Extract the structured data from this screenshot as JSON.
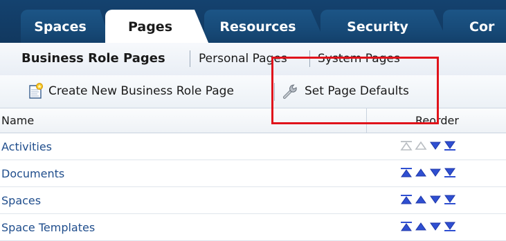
{
  "tabs": [
    {
      "label": "Spaces",
      "active": false
    },
    {
      "label": "Pages",
      "active": true
    },
    {
      "label": "Resources",
      "active": false
    },
    {
      "label": "Security",
      "active": false
    },
    {
      "label": "Cor",
      "active": false
    }
  ],
  "subnav": {
    "items": [
      {
        "label": "Business Role Pages",
        "selected": true
      },
      {
        "label": "Personal Pages",
        "selected": false
      },
      {
        "label": "System Pages",
        "selected": false
      }
    ]
  },
  "toolbar": {
    "create_label": "Create New Business Role Page",
    "defaults_label": "Set Page Defaults"
  },
  "table": {
    "columns": [
      "Name",
      "Reorder"
    ],
    "rows": [
      {
        "name": "Activities",
        "move_up_enabled": false
      },
      {
        "name": "Documents",
        "move_up_enabled": true
      },
      {
        "name": "Spaces",
        "move_up_enabled": true
      },
      {
        "name": "Space Templates",
        "move_up_enabled": true
      }
    ]
  },
  "colors": {
    "tabbar_dark": "#14426f",
    "arrow_enabled": "#2f4fd1",
    "arrow_disabled": "#b9bdc2",
    "annotation": "#e0131b",
    "link": "#1f4d8c"
  },
  "icons": {
    "create": "new-page-icon",
    "defaults": "wrench-icon",
    "reorder": [
      "move-top-icon",
      "move-up-icon",
      "move-down-icon",
      "move-bottom-icon"
    ]
  }
}
